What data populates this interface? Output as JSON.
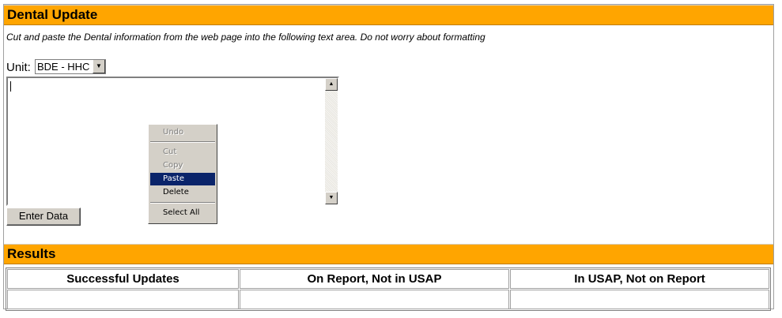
{
  "dental_section": {
    "title": "Dental Update",
    "instructions": "Cut and paste the Dental information from the web page into the following text area. Do not worry about formatting",
    "unit_label": "Unit:",
    "unit_selected": "BDE - HHC",
    "textarea_value": "",
    "enter_button_label": "Enter Data"
  },
  "context_menu": {
    "items": [
      {
        "label": "Undo",
        "enabled": false
      },
      {
        "label": "Cut",
        "enabled": false
      },
      {
        "label": "Copy",
        "enabled": false
      },
      {
        "label": "Paste",
        "enabled": true,
        "selected": true
      },
      {
        "label": "Delete",
        "enabled": true
      },
      {
        "label": "Select All",
        "enabled": true
      }
    ]
  },
  "results_section": {
    "title": "Results",
    "columns": [
      "Successful Updates",
      "On Report, Not in USAP",
      "In USAP, Not on Report"
    ],
    "rows": [
      [
        "",
        "",
        ""
      ]
    ]
  },
  "colors": {
    "header_bg": "#ffa500",
    "menu_highlight": "#0a246a"
  }
}
